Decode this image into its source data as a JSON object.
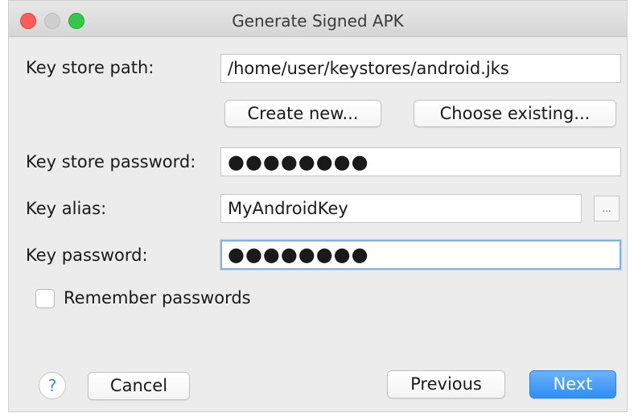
{
  "window": {
    "title": "Generate Signed APK"
  },
  "form": {
    "key_store_path_label": "Key store path:",
    "key_store_path_value": "/home/user/keystores/android.jks",
    "create_new_label": "Create new...",
    "choose_existing_label": "Choose existing...",
    "key_store_password_label": "Key store password:",
    "key_store_password_value": "●●●●●●●●",
    "key_alias_label": "Key alias:",
    "key_alias_value": "MyAndroidKey",
    "browse_label": "...",
    "key_password_label": "Key password:",
    "key_password_value": "●●●●●●●●",
    "remember_passwords_label": "Remember passwords",
    "remember_passwords_checked": false
  },
  "footer": {
    "help_label": "?",
    "cancel_label": "Cancel",
    "previous_label": "Previous",
    "next_label": "Next"
  },
  "colors": {
    "accent": "#2f8ef5",
    "close": "#fc5f57",
    "zoom": "#34c84a"
  }
}
